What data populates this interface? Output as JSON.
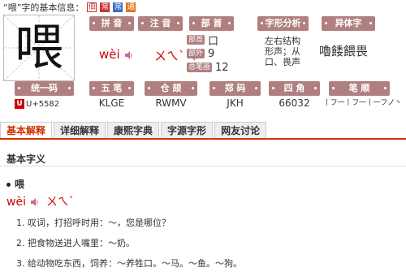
{
  "header": {
    "title": "“喂”字的基本信息：",
    "badges": [
      "佃",
      "常",
      "常",
      "通"
    ]
  },
  "character": {
    "glyph": "喂"
  },
  "fields": {
    "pinyin_head": "拼 音",
    "pinyin": "wèi",
    "zhuyin_head": "注 音",
    "zhuyin": "ㄨㄟˋ",
    "bushou_head": "部 首",
    "bushou_tag": "部首",
    "bushou": "口",
    "buwai_tag": "部外",
    "buwai": "9",
    "zongbihua_tag": "总笔画",
    "zongbihua": "12",
    "zixing_head": "字形分析",
    "zixing_lines": [
      "左右结构",
      "形声；从",
      "口、畏声"
    ],
    "yitizi_head": "异体字",
    "yitizi": "嚕餧餵畏",
    "tongyima_head": "统一码",
    "tongyima": "U+5582",
    "unicode_logo": "U",
    "wubi_head": "五 笔",
    "wubi": "KLGE",
    "cangjie_head": "仓 颉",
    "cangjie": "RWMV",
    "zhengma_head": "郑 码",
    "zhengma": "JKH",
    "sijiao_head": "四 角",
    "sijiao": "66032",
    "bishun_head": "笔 顺",
    "bishun": "丨フ一丨フ一丨一フノ丶"
  },
  "tabs": [
    "基本解释",
    "详细解释",
    "康熙字典",
    "字源字形",
    "网友讨论"
  ],
  "content": {
    "section_title": "基本字义",
    "entry_char": "喂",
    "pinyin": "wèi",
    "zhuyin": "ㄨㄟˋ",
    "definitions": [
      "1. 叹词，打招呼时用：～，您是哪位？",
      "2. 把食物送进人嘴里：～奶。",
      "3. 给动物吃东西，饲养：～养牲口。～马。～鱼。～狗。"
    ]
  },
  "colors": {
    "accent": "#c30000",
    "head_bg": "#b08080"
  },
  "icons": {
    "sound": "speaker-icon"
  }
}
